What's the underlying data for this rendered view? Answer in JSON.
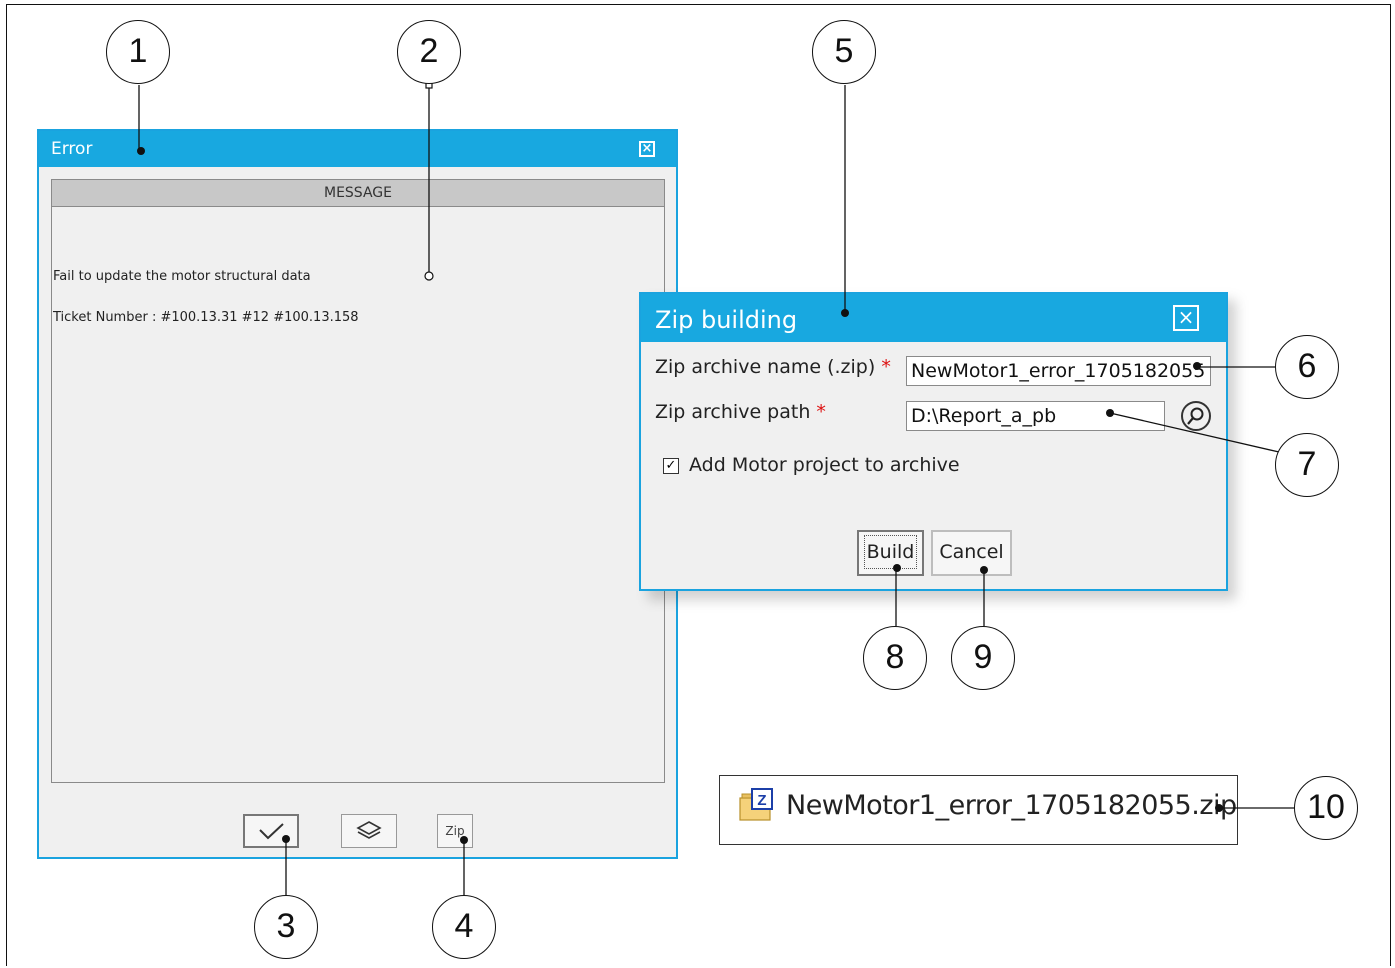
{
  "error_window": {
    "title": "Error",
    "message_header": "MESSAGE",
    "message_lines": [
      "Fail to update the motor structural data",
      "Ticket Number : #100.13.31 #12 #100.13.158"
    ],
    "zip_button_label": "Zip"
  },
  "zip_dialog": {
    "title": "Zip building",
    "archive_name_label": "Zip archive name (.zip)",
    "archive_name_value": "NewMotor1_error_1705182055",
    "archive_path_label": "Zip archive path",
    "archive_path_value": "D:\\Report_a_pb",
    "required_marker": "*",
    "add_project_label": "Add Motor project to archive",
    "add_project_checked": true,
    "build_label": "Build",
    "cancel_label": "Cancel"
  },
  "file_result": {
    "filename": "NewMotor1_error_1705182055.zip",
    "icon_letter": "Z"
  },
  "callouts": [
    "1",
    "2",
    "3",
    "4",
    "5",
    "6",
    "7",
    "8",
    "9",
    "10"
  ],
  "colors": {
    "title_bar": "#18a8e0",
    "window_bg": "#f0f0f0",
    "required": "#d11111"
  }
}
